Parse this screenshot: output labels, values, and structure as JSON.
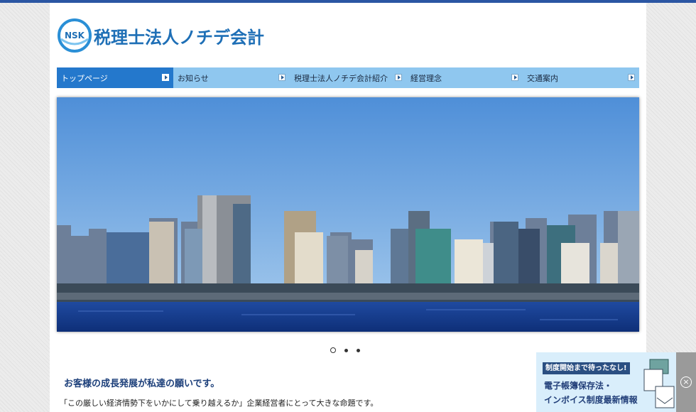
{
  "site": {
    "logo_mark": "NSK",
    "logo_text": "税理士法人ノチデ会計"
  },
  "nav": {
    "items": [
      {
        "label": "トップページ",
        "active": true
      },
      {
        "label": "お知らせ",
        "active": false
      },
      {
        "label": "税理士法人ノチデ会計紹介",
        "active": false
      },
      {
        "label": "経営理念",
        "active": false
      },
      {
        "label": "交通案内",
        "active": false
      }
    ]
  },
  "slider": {
    "slide_count": 3,
    "current": 1
  },
  "main": {
    "heading": "お客様の成長発展が私達の願いです。",
    "text": "「この厳しい経済情勢下をいかにして乗り越えるか」企業経営者にとって大きな命題です。"
  },
  "banner": {
    "tag": "制度開始まで待ったなし!",
    "line1": "電子帳簿保存法・",
    "line2": "インボイス制度最新情報"
  },
  "colors": {
    "brand": "#2b56a3",
    "nav_active": "#2478cc",
    "nav_bg": "#8fc7ef",
    "heading": "#1c3f7a"
  }
}
